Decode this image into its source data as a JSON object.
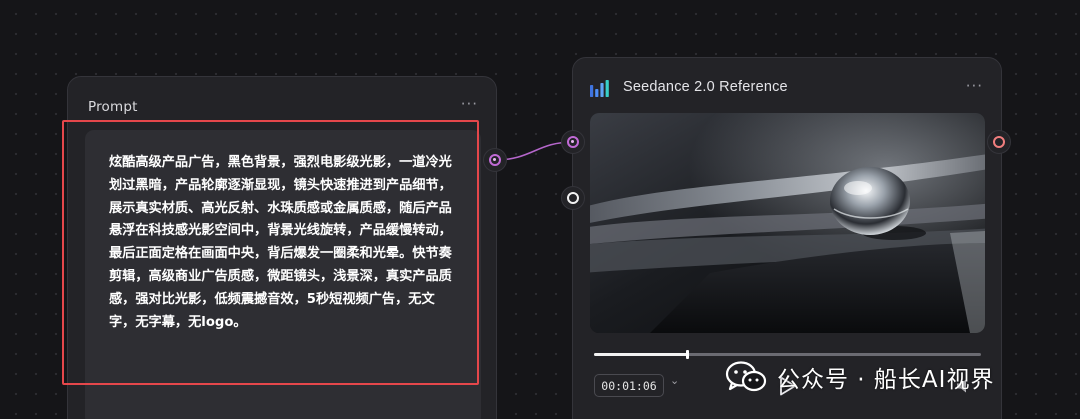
{
  "prompt_node": {
    "title": "Prompt",
    "menu": "···",
    "text": "炫酷高级产品广告，黑色背景，强烈电影级光影，一道冷光划过黑暗，产品轮廓逐渐显现，镜头快速推进到产品细节，展示真实材质、高光反射、水珠质感或金属质感，随后产品悬浮在科技感光影空间中，背景光线旋转，产品缓慢转动，最后正面定格在画面中央，背后爆发一圈柔和光晕。快节奏剪辑，高级商业广告质感，微距镜头，浅景深，真实产品质感，强对比光影，低频震撼音效，5秒短视频广告，无文字，无字幕，无logo。"
  },
  "seedance_node": {
    "title": "Seedance 2.0 Reference",
    "menu": "···",
    "timecode": "00:01:06",
    "progress": 0.24
  },
  "watermark": {
    "text": "公众号 · 船长AI视界"
  },
  "colors": {
    "canvas": "#151518",
    "node": "#232327",
    "textarea": "#2e2e33",
    "accent_purple": "#c16ad6",
    "accent_coral": "#f07e7e",
    "highlight_red": "#e5474b",
    "logo_blue": "#4d8df7",
    "logo_teal": "#38d0c8"
  }
}
